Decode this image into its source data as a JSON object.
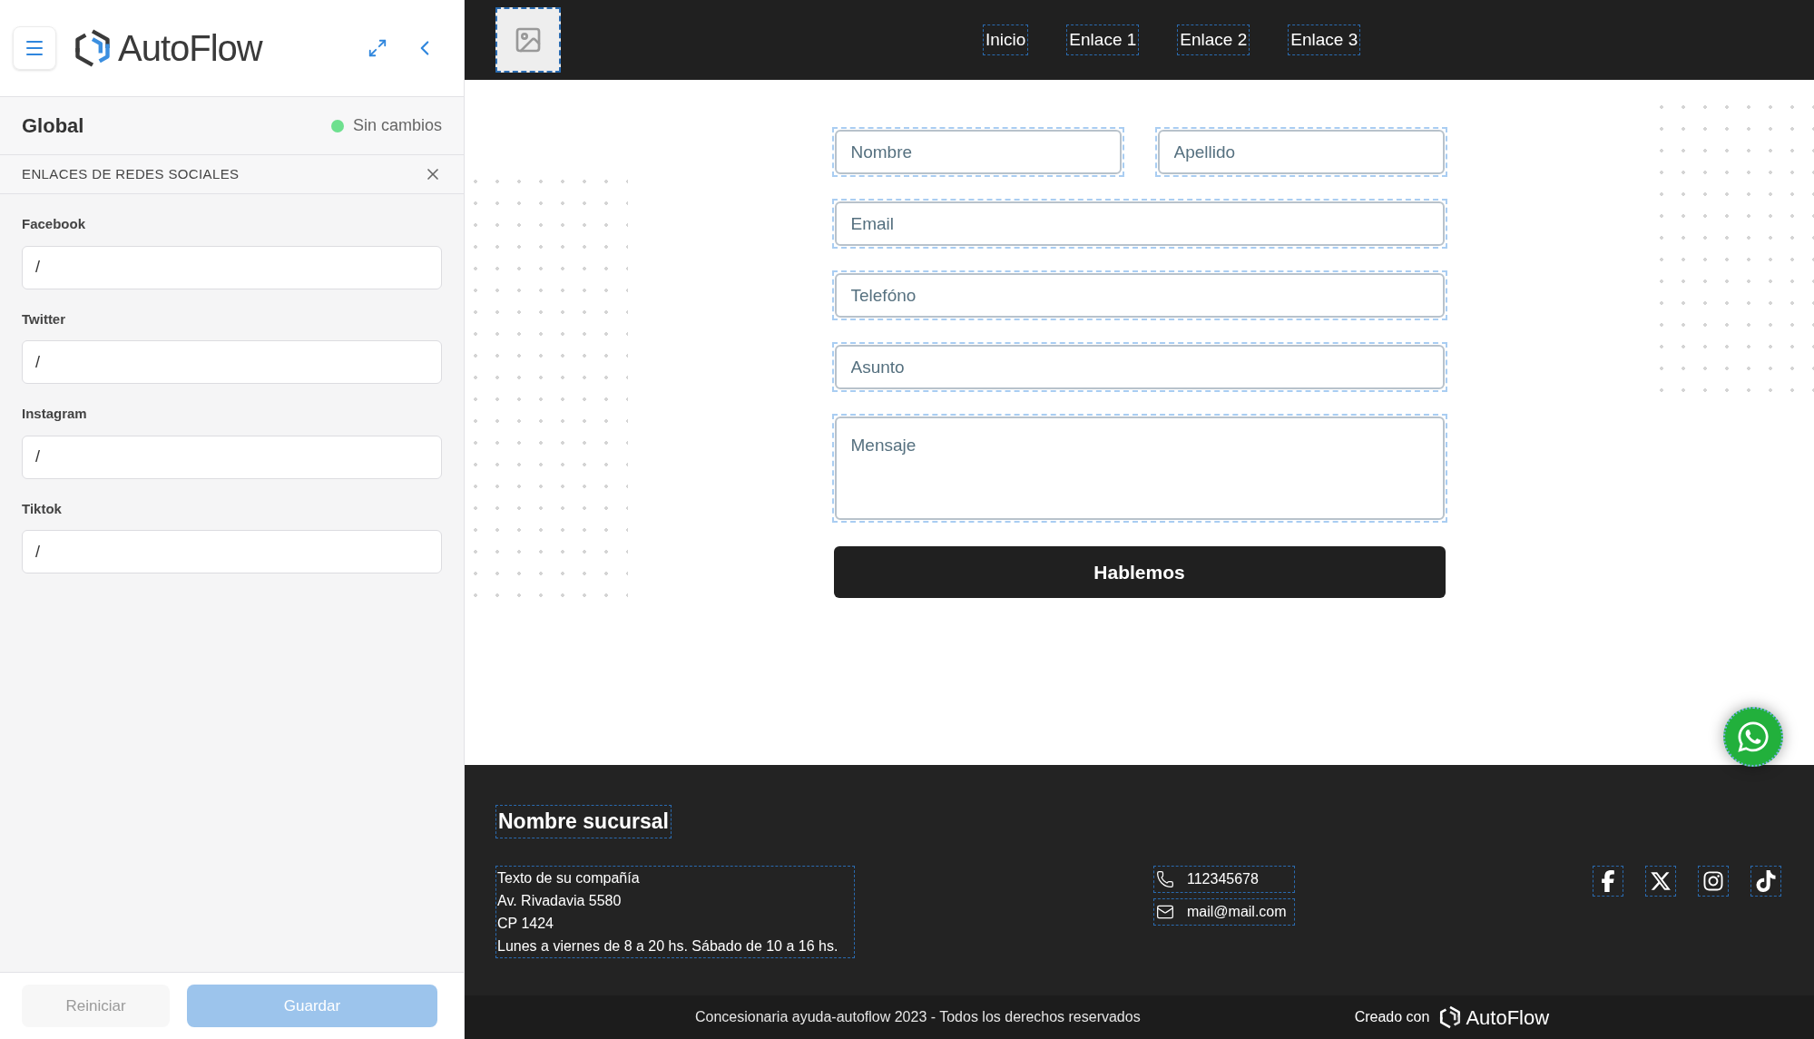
{
  "sidebar": {
    "logo_text": "AutoFlow",
    "panel_title": "Global",
    "status": "Sin cambios",
    "section_title": "ENLACES DE REDES SOCIALES",
    "fields": [
      {
        "label": "Facebook",
        "value": "/"
      },
      {
        "label": "Twitter",
        "value": "/"
      },
      {
        "label": "Instagram",
        "value": "/"
      },
      {
        "label": "Tiktok",
        "value": "/"
      }
    ],
    "buttons": [
      {
        "label": "Reiniciar",
        "kind": "secondary",
        "disabled": true
      },
      {
        "label": "Guardar",
        "kind": "primary",
        "disabled": true
      }
    ]
  },
  "header": {
    "nav": [
      "Inicio",
      "Enlace 1",
      "Enlace 2",
      "Enlace 3"
    ]
  },
  "form": {
    "fields": [
      {
        "placeholder": "Nombre",
        "kind": "half"
      },
      {
        "placeholder": "Apellido",
        "kind": "half"
      },
      {
        "placeholder": "Email",
        "kind": "full"
      },
      {
        "placeholder": "Telefóno",
        "kind": "full"
      },
      {
        "placeholder": "Asunto",
        "kind": "full"
      },
      {
        "placeholder": "Mensaje",
        "kind": "textarea"
      }
    ],
    "submit": "Hablemos"
  },
  "footer": {
    "branch_name": "Nombre sucursal",
    "address_lines": [
      "Texto de su compañía",
      "Av. Rivadavia 5580",
      "CP 1424",
      "Lunes a viernes de 8 a 20 hs. Sábado de 10 a 16 hs."
    ],
    "contacts": [
      {
        "kind": "phone",
        "text": "112345678"
      },
      {
        "kind": "mail",
        "text": "mail@mail.com"
      }
    ],
    "socials": [
      {
        "kind": "facebook"
      },
      {
        "kind": "x"
      },
      {
        "kind": "instagram"
      },
      {
        "kind": "tiktok"
      }
    ],
    "copyright": "Concesionaria ayuda-autoflow 2023 - Todos los derechos reservados",
    "credit": "Creado con",
    "credit_logo": "AutoFlow"
  }
}
